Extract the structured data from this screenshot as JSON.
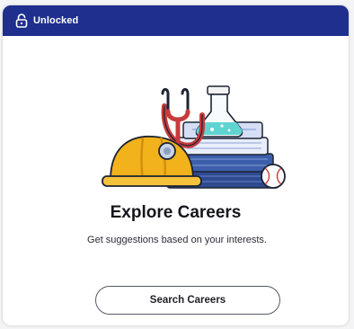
{
  "header": {
    "icon": "unlocked-icon",
    "label": "Unlocked",
    "background": "#1e2f8e"
  },
  "illustration": {
    "icons": [
      "hard-hat-icon",
      "stethoscope-icon",
      "books-icon",
      "flask-icon",
      "baseball-icon"
    ]
  },
  "content": {
    "title": "Explore Careers",
    "description": "Get suggestions based on your interests."
  },
  "actions": {
    "search_label": "Search Careers"
  }
}
